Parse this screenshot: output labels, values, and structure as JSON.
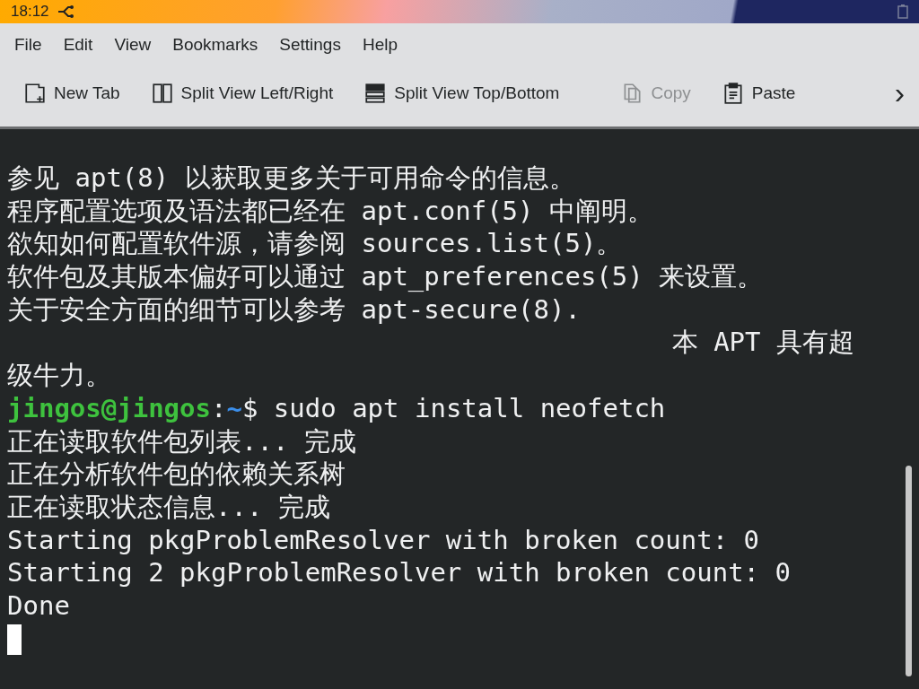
{
  "status_bar": {
    "time": "18:12"
  },
  "menu": [
    {
      "label": "File"
    },
    {
      "label": "Edit"
    },
    {
      "label": "View"
    },
    {
      "label": "Bookmarks"
    },
    {
      "label": "Settings"
    },
    {
      "label": "Help"
    }
  ],
  "toolbar": [
    {
      "label": "New Tab",
      "kind": "new-tab",
      "disabled": false
    },
    {
      "label": "Split View Left/Right",
      "kind": "split-lr",
      "disabled": false
    },
    {
      "label": "Split View Top/Bottom",
      "kind": "split-tb",
      "disabled": false
    },
    {
      "label": "Copy",
      "kind": "copy",
      "disabled": true
    },
    {
      "label": "Paste",
      "kind": "paste",
      "disabled": false
    },
    {
      "label": "›",
      "kind": "more",
      "disabled": false
    }
  ],
  "terminal": {
    "lines": [
      [
        {
          "text": "参见 apt(8) 以获取更多关于可用命令的信息。",
          "kind": "plain"
        }
      ],
      [
        {
          "text": "程序配置选项及语法都已经在 apt.conf(5) 中阐明。",
          "kind": "plain"
        }
      ],
      [
        {
          "text": "欲知如何配置软件源，请参阅 sources.list(5)。",
          "kind": "plain"
        }
      ],
      [
        {
          "text": "软件包及其版本偏好可以通过 apt_preferences(5) 来设置。",
          "kind": "plain"
        }
      ],
      [
        {
          "text": "关于安全方面的细节可以参考 apt-secure(8).",
          "kind": "plain"
        }
      ],
      [
        {
          "text": "本 APT 具有超",
          "kind": "right"
        }
      ],
      [
        {
          "text": "级牛力。",
          "kind": "plain"
        }
      ],
      [
        {
          "text": "jingos@jingos",
          "kind": "user"
        },
        {
          "text": ":",
          "kind": "plain"
        },
        {
          "text": "~",
          "kind": "path"
        },
        {
          "text": "$ sudo apt install neofetch",
          "kind": "plain"
        }
      ],
      [
        {
          "text": "正在读取软件包列表... 完成",
          "kind": "plain"
        }
      ],
      [
        {
          "text": "正在分析软件包的依赖关系树",
          "kind": "plain"
        }
      ],
      [
        {
          "text": "正在读取状态信息... 完成",
          "kind": "plain"
        }
      ],
      [
        {
          "text": "Starting pkgProblemResolver with broken count: 0",
          "kind": "plain"
        }
      ],
      [
        {
          "text": "Starting 2 pkgProblemResolver with broken count: 0",
          "kind": "plain"
        }
      ],
      [
        {
          "text": "Done",
          "kind": "plain"
        }
      ]
    ]
  }
}
